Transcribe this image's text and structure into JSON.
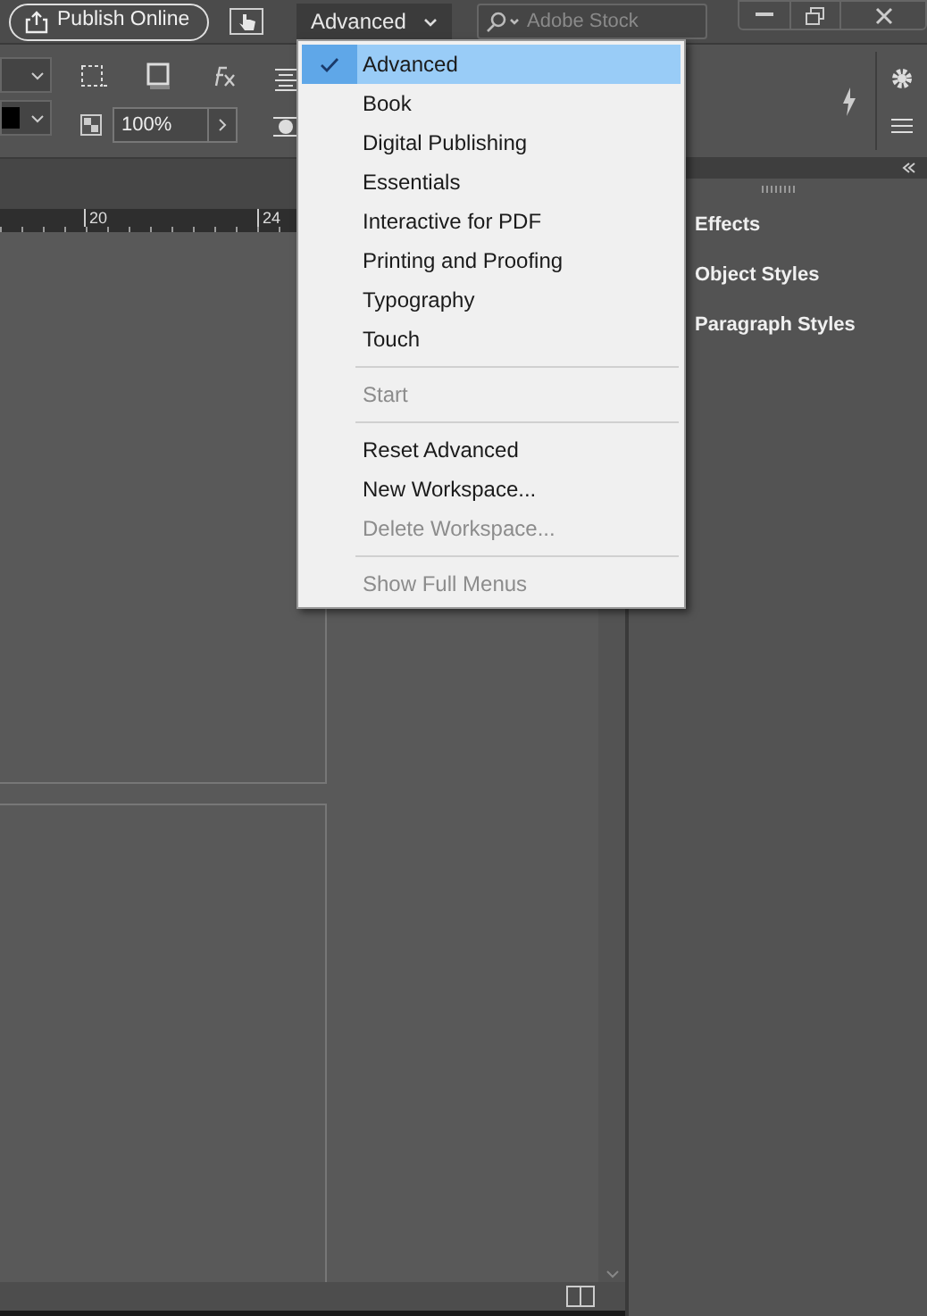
{
  "top_bar": {
    "publish_button": "Publish Online",
    "workspace_dropdown": "Advanced",
    "search": {
      "placeholder": "Adobe Stock"
    }
  },
  "control_panel": {
    "opacity_field": "100%"
  },
  "ruler": {
    "labels": [
      "20",
      "24"
    ]
  },
  "workspace_menu": [
    {
      "kind": "item",
      "label": "Advanced",
      "checked": true,
      "selected": true,
      "disabled": false
    },
    {
      "kind": "item",
      "label": "Book",
      "checked": false,
      "selected": false,
      "disabled": false
    },
    {
      "kind": "item",
      "label": "Digital Publishing",
      "checked": false,
      "selected": false,
      "disabled": false
    },
    {
      "kind": "item",
      "label": "Essentials",
      "checked": false,
      "selected": false,
      "disabled": false
    },
    {
      "kind": "item",
      "label": "Interactive for PDF",
      "checked": false,
      "selected": false,
      "disabled": false
    },
    {
      "kind": "item",
      "label": "Printing and Proofing",
      "checked": false,
      "selected": false,
      "disabled": false
    },
    {
      "kind": "item",
      "label": "Typography",
      "checked": false,
      "selected": false,
      "disabled": false
    },
    {
      "kind": "item",
      "label": "Touch",
      "checked": false,
      "selected": false,
      "disabled": false
    },
    {
      "kind": "separator"
    },
    {
      "kind": "item",
      "label": "Start",
      "checked": false,
      "selected": false,
      "disabled": true
    },
    {
      "kind": "separator"
    },
    {
      "kind": "item",
      "label": "Reset Advanced",
      "checked": false,
      "selected": false,
      "disabled": false
    },
    {
      "kind": "item",
      "label": "New Workspace...",
      "checked": false,
      "selected": false,
      "disabled": false
    },
    {
      "kind": "item",
      "label": "Delete Workspace...",
      "checked": false,
      "selected": false,
      "disabled": true
    },
    {
      "kind": "separator"
    },
    {
      "kind": "item",
      "label": "Show Full Menus",
      "checked": false,
      "selected": false,
      "disabled": true
    }
  ],
  "panels": [
    {
      "label": "Effects"
    },
    {
      "label": "Object Styles"
    },
    {
      "label": "Paragraph Styles"
    }
  ]
}
